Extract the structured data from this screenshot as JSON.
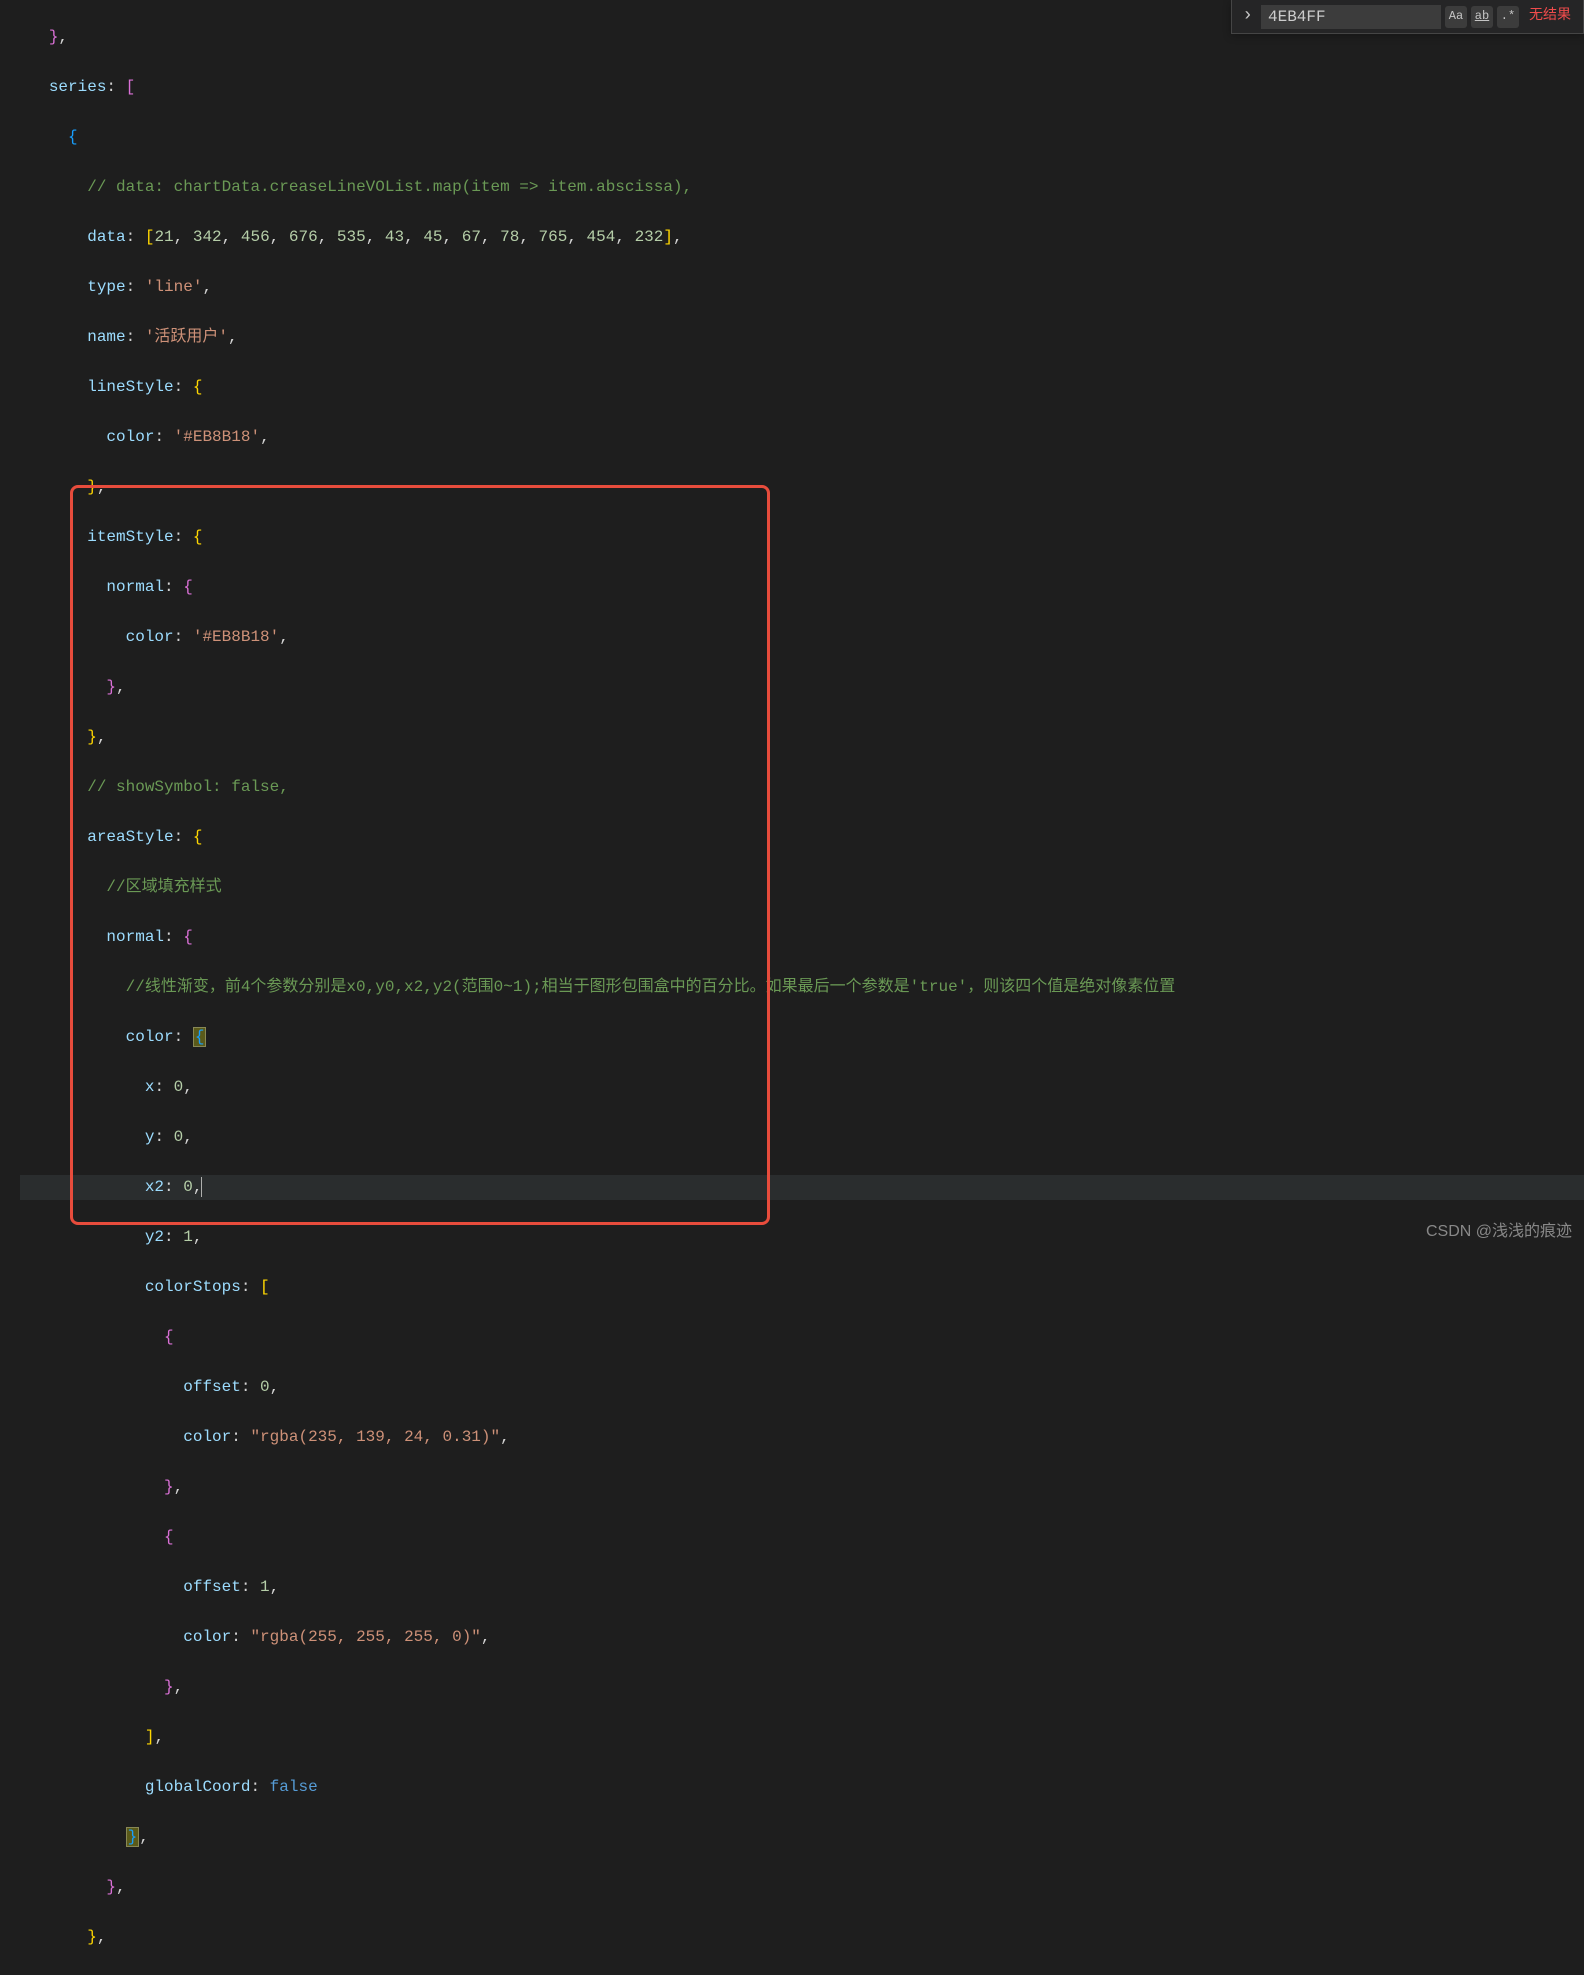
{
  "search": {
    "value": "4EB4FF",
    "case_label": "Aa",
    "word_label": "ab",
    "regex_label": ".*",
    "results": "无结果"
  },
  "watermark": "CSDN @浅浅的痕迹",
  "code": {
    "l1": "},",
    "l2_series": "series",
    "l3": "{",
    "l4_comment": "// data: chartData.creaseLineVOList.map(item => item.abscissa),",
    "l5_data": "data",
    "l5_vals": [
      "21",
      "342",
      "456",
      "676",
      "535",
      "43",
      "45",
      "67",
      "78",
      "765",
      "454",
      "232"
    ],
    "l6_type": "type",
    "l6_val": "'line'",
    "l7_name": "name",
    "l7_val": "'活跃用户'",
    "l8_lineStyle": "lineStyle",
    "l9_color": "color",
    "l9_val": "'#EB8B18'",
    "l10": "},",
    "l11_itemStyle": "itemStyle",
    "l12_normal": "normal",
    "l13_color": "color",
    "l13_val": "'#EB8B18'",
    "l14": "},",
    "l15": "},",
    "l16_comment": "// showSymbol: false,",
    "l17_areaStyle": "areaStyle",
    "l18_comment": "//区域填充样式",
    "l19_normal": "normal",
    "l20_comment": "//线性渐变，前4个参数分别是x0,y0,x2,y2(范围0~1);相当于图形包围盒中的百分比。如果最后一个参数是'true'，则该四个值是绝对像素位置",
    "l21_color": "color",
    "l22_x": "x",
    "l22_val": "0",
    "l23_y": "y",
    "l23_val": "0",
    "l24_x2": "x2",
    "l24_val": "0",
    "l25_y2": "y2",
    "l25_val": "1",
    "l26_colorStops": "colorStops",
    "l27": "{",
    "l28_offset": "offset",
    "l28_val": "0",
    "l29_color": "color",
    "l29_val": "\"rgba(235, 139, 24, 0.31)\"",
    "l30": "},",
    "l31": "{",
    "l32_offset": "offset",
    "l32_val": "1",
    "l33_color": "color",
    "l33_val": "\"rgba(255, 255, 255, 0)\"",
    "l34": "},",
    "l35": "],",
    "l36_globalCoord": "globalCoord",
    "l36_val": "false",
    "l37": "},",
    "l38": "},",
    "l39": "},"
  }
}
